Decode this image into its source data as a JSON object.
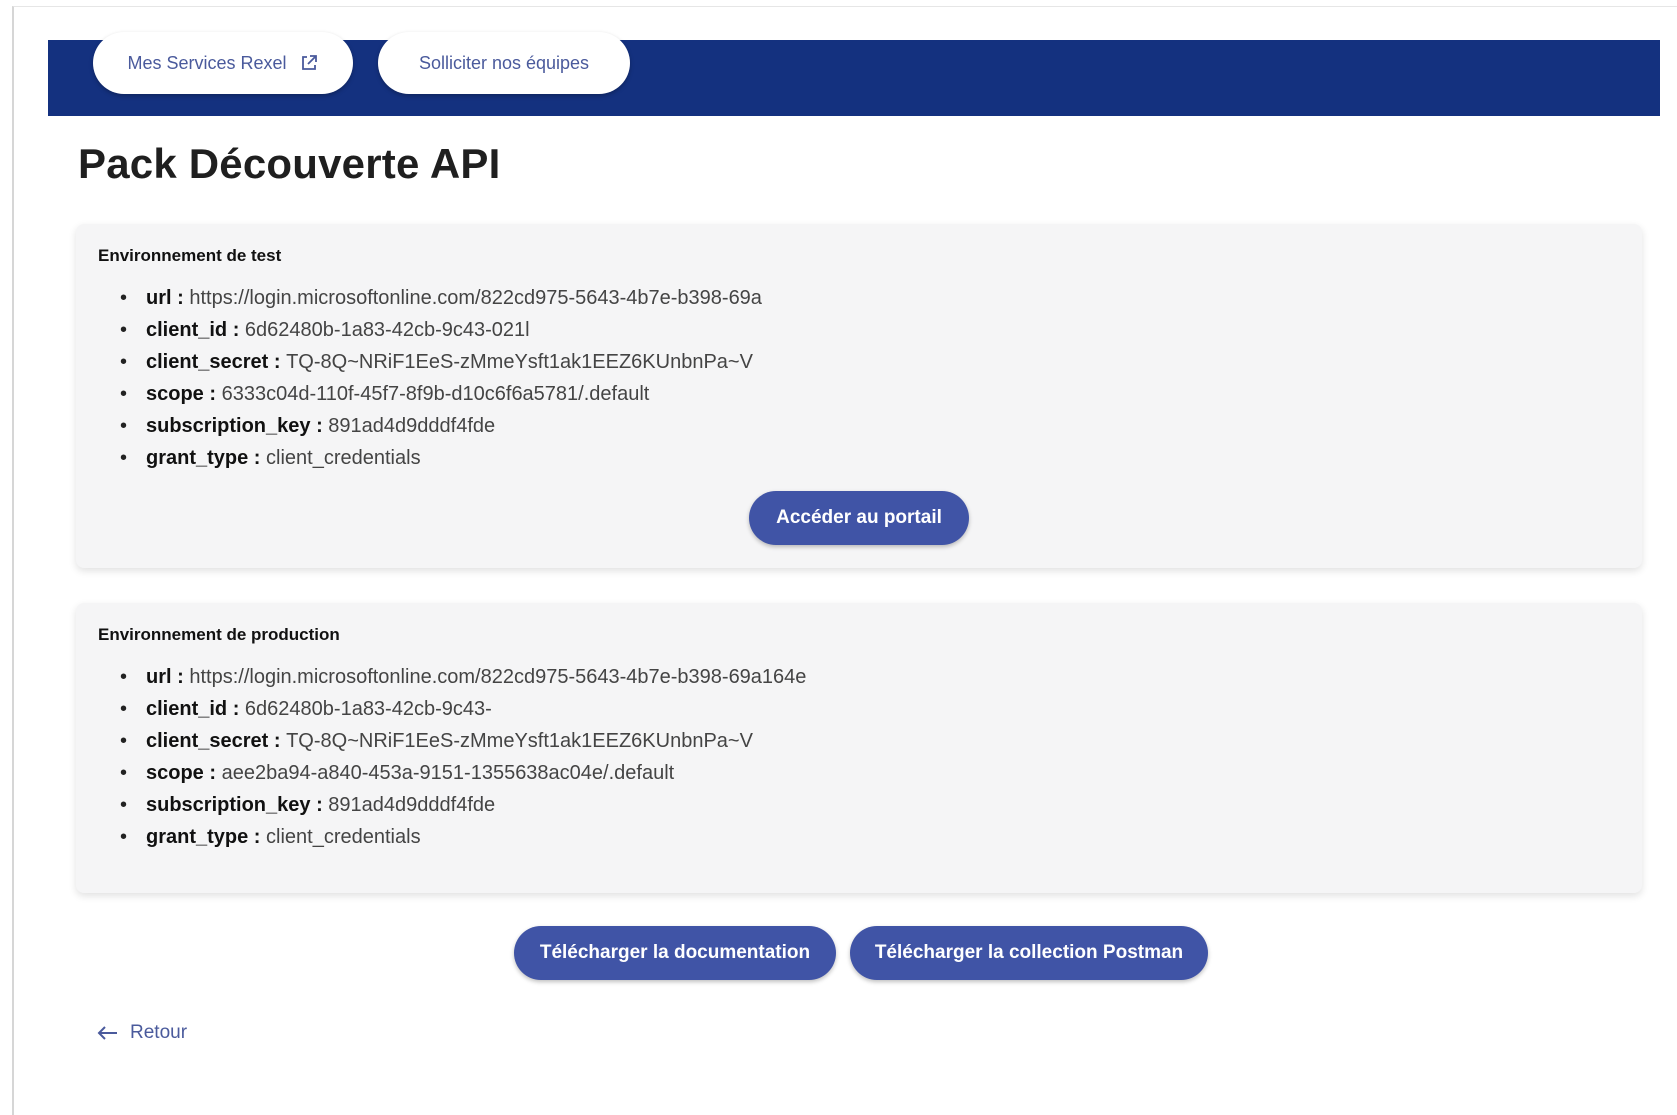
{
  "nav": {
    "services_label": "Mes Services Rexel",
    "teams_label": "Solliciter nos équipes"
  },
  "page": {
    "title": "Pack Découverte API"
  },
  "test_env": {
    "heading": "Environnement de test",
    "items": [
      {
        "key": "url",
        "value": "https://login.microsoftonline.com/822cd975-5643-4b7e-b398-69a"
      },
      {
        "key": "client_id",
        "value": "6d62480b-1a83-42cb-9c43-021l"
      },
      {
        "key": "client_secret",
        "value": "TQ-8Q~NRiF1EeS-zMmeYsft1ak1EEZ6KUnbnPa~V"
      },
      {
        "key": "scope",
        "value": "6333c04d-110f-45f7-8f9b-d10c6f6a5781/.default"
      },
      {
        "key": "subscription_key",
        "value": "891ad4d9dddf4fde"
      },
      {
        "key": "grant_type",
        "value": "client_credentials"
      }
    ],
    "portal_button": "Accéder au portail"
  },
  "prod_env": {
    "heading": "Environnement de production",
    "items": [
      {
        "key": "url",
        "value": "https://login.microsoftonline.com/822cd975-5643-4b7e-b398-69a164e"
      },
      {
        "key": "client_id",
        "value": "6d62480b-1a83-42cb-9c43-"
      },
      {
        "key": "client_secret",
        "value": "TQ-8Q~NRiF1EeS-zMmeYsft1ak1EEZ6KUnbnPa~V"
      },
      {
        "key": "scope",
        "value": "aee2ba94-a840-453a-9151-1355638ac04e/.default"
      },
      {
        "key": "subscription_key",
        "value": "891ad4d9dddf4fde"
      },
      {
        "key": "grant_type",
        "value": "client_credentials"
      }
    ]
  },
  "actions": {
    "download_doc": "Télécharger la documentation",
    "download_postman": "Télécharger la collection Postman",
    "back": "Retour"
  },
  "colors": {
    "header_bg": "#14317f",
    "button_bg": "#4054a6",
    "link": "#4a5a9c",
    "card_bg": "#f5f5f6"
  },
  "icons": {
    "external_link": "external-link-icon",
    "back_arrow": "arrow-left-icon"
  }
}
